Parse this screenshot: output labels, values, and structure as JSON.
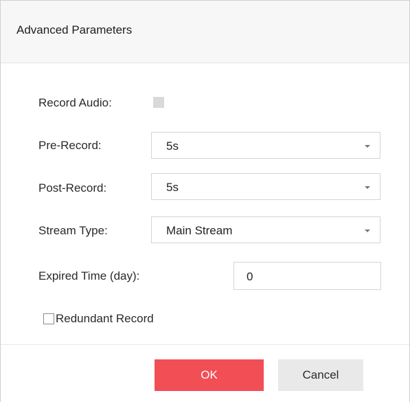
{
  "dialog": {
    "title": "Advanced Parameters"
  },
  "fields": {
    "record_audio": {
      "label": "Record Audio:",
      "checked": false
    },
    "pre_record": {
      "label": "Pre-Record:",
      "value": "5s"
    },
    "post_record": {
      "label": "Post-Record:",
      "value": "5s"
    },
    "stream_type": {
      "label": "Stream Type:",
      "value": "Main Stream"
    },
    "expired_time": {
      "label": "Expired Time (day):",
      "value": "0"
    },
    "redundant_record": {
      "label": "Redundant Record",
      "checked": false
    }
  },
  "buttons": {
    "ok": "OK",
    "cancel": "Cancel"
  },
  "colors": {
    "ok_button": "#f24e55",
    "cancel_button": "#e9e9e9",
    "header_bg": "#f7f7f7"
  }
}
